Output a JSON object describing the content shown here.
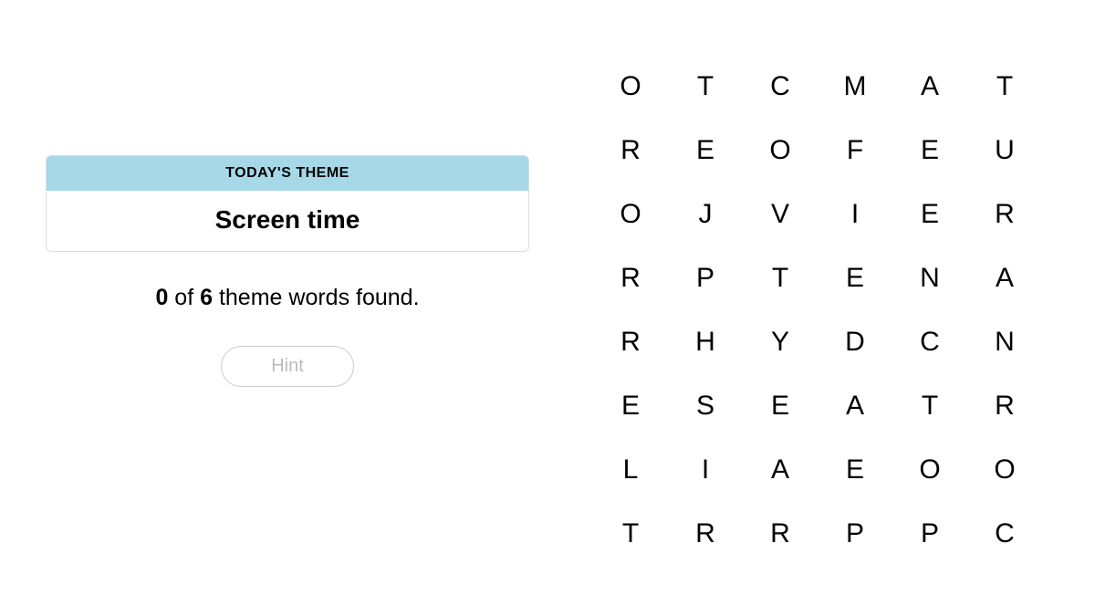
{
  "theme": {
    "header_label": "TODAY'S THEME",
    "title": "Screen time"
  },
  "progress": {
    "found": "0",
    "total": "6",
    "middle_text": " of ",
    "suffix_text": " theme words found."
  },
  "hint": {
    "label": "Hint"
  },
  "grid": {
    "rows": [
      [
        "O",
        "T",
        "C",
        "M",
        "A",
        "T"
      ],
      [
        "R",
        "E",
        "O",
        "F",
        "E",
        "U"
      ],
      [
        "O",
        "J",
        "V",
        "I",
        "E",
        "R"
      ],
      [
        "R",
        "P",
        "T",
        "E",
        "N",
        "A"
      ],
      [
        "R",
        "H",
        "Y",
        "D",
        "C",
        "N"
      ],
      [
        "E",
        "S",
        "E",
        "A",
        "T",
        "R"
      ],
      [
        "L",
        "I",
        "A",
        "E",
        "O",
        "O"
      ],
      [
        "T",
        "R",
        "R",
        "P",
        "P",
        "C"
      ]
    ]
  }
}
